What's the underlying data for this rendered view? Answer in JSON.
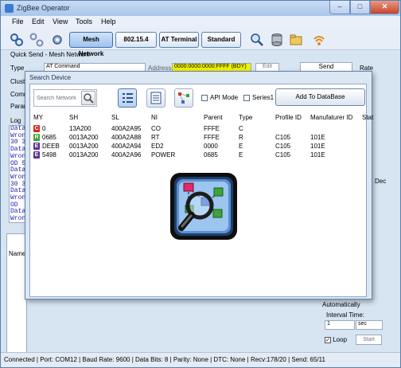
{
  "window": {
    "title": "ZigBee Operator"
  },
  "menu": [
    "File",
    "Edit",
    "View",
    "Tools",
    "Help"
  ],
  "toolbar": {
    "modes": [
      "Mesh Network",
      "802.15.4",
      "AT Terminal",
      "Standard"
    ],
    "active_mode": "Mesh Network"
  },
  "quick_send": {
    "header": "Quick Send - Mesh Network",
    "type_label": "Type",
    "type_value": "AT Command",
    "address_label": "Address",
    "address_value": "0000:0000:0000:FFFF (BDY)",
    "edit_label": "Edit",
    "send_label": "Send",
    "rate_label": "Rate",
    "cluster_label": "Cluste",
    "command_label": "Comm",
    "param_label": "Param",
    "right_label": "Dec"
  },
  "log": {
    "label": "Log",
    "lines": [
      "Data",
      "Wron",
      "30 3",
      "Data",
      "Wron",
      "OD 5",
      "Data",
      "Wron",
      "30 3",
      "Data",
      "Wron",
      "OD",
      "Data",
      "Wron"
    ]
  },
  "lower": {
    "name_header": "Name"
  },
  "right_panel": {
    "automatic_label": "Automatically",
    "interval_label": "Interval Time:",
    "interval_value": "1",
    "interval_unit": "sec",
    "loop_label": "Loop",
    "start_label": "Start"
  },
  "status_bar": "Connected | Port: COM12 | Baud Rate: 9600 | Data Bits: 8 | Parity: None | DTC: None | Recv:178/20 | Send: 65/11",
  "dialog": {
    "title": "Search Device",
    "search_placeholder": "Search Network",
    "api_mode_label": "API Mode",
    "series1_label": "Series1",
    "add_button": "Add To DataBase",
    "columns": [
      "MY",
      "SH",
      "SL",
      "NI",
      "Parent",
      "Type",
      "Profile ID",
      "Manufaturer ID",
      "Stat"
    ],
    "rows": [
      {
        "badge": "C",
        "badge_color": "#d42a1a",
        "my": "0",
        "sh": "13A200",
        "sl": "400A2A95",
        "ni": "CO",
        "parent": "FFFE",
        "type": "C",
        "profile": "",
        "manuf": ""
      },
      {
        "badge": "R",
        "badge_color": "#3da33a",
        "my": "0685",
        "sh": "0013A200",
        "sl": "400A2A88",
        "ni": "RT",
        "parent": "FFFE",
        "type": "R",
        "profile": "C105",
        "manuf": "101E"
      },
      {
        "badge": "E",
        "badge_color": "#5b2f91",
        "my": "DEEB",
        "sh": "0013A200",
        "sl": "400A2A94",
        "ni": "ED2",
        "parent": "0000",
        "type": "E",
        "profile": "C105",
        "manuf": "101E"
      },
      {
        "badge": "E",
        "badge_color": "#5b2f91",
        "my": "5498",
        "sh": "0013A200",
        "sl": "400A2A96",
        "ni": "POWER",
        "parent": "0685",
        "type": "E",
        "profile": "C105",
        "manuf": "101E"
      }
    ]
  },
  "colors": {
    "accent": "#3d6fae",
    "address_highlight": "#f0f000",
    "log_text": "#1a1ab5"
  }
}
